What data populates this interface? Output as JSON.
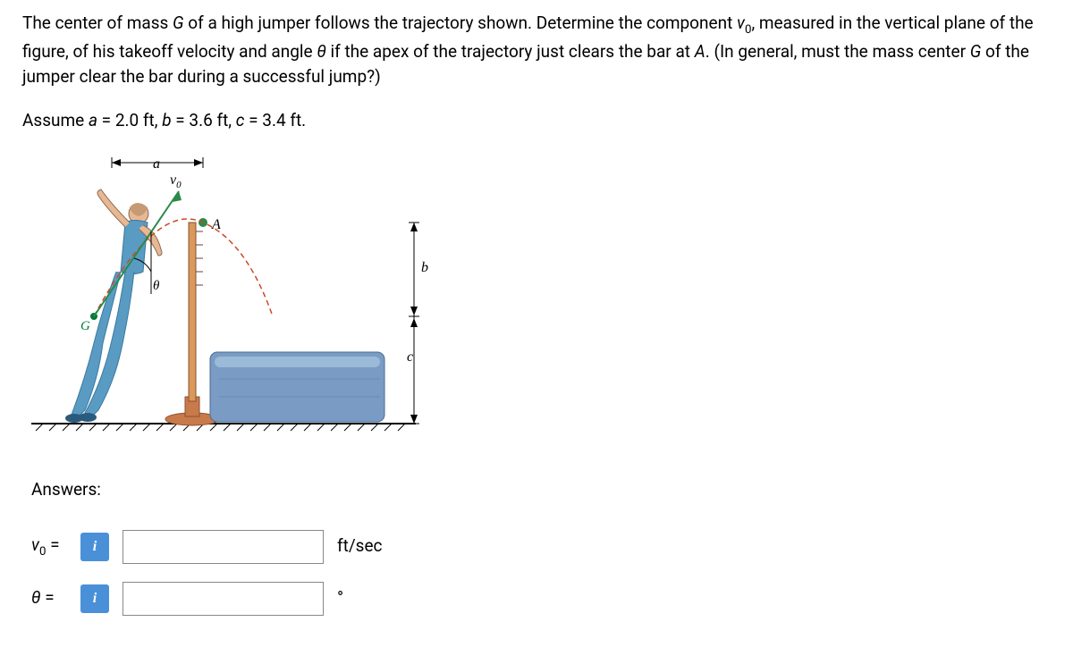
{
  "problem": {
    "text_part1": "The center of mass ",
    "text_G": "G",
    "text_part2": " of a high jumper follows the trajectory shown. Determine the component ",
    "text_v": "v",
    "text_sub0_1": "0",
    "text_part3": ", measured in the vertical plane of the figure, of his takeoff velocity and angle ",
    "text_theta": "θ",
    "text_part4": " if the apex of the trajectory just clears the bar at ",
    "text_A": "A",
    "text_part5": ". (In general, must the mass center ",
    "text_G2": "G",
    "text_part6": " of the jumper clear the bar during a successful jump?)"
  },
  "assume": {
    "prefix": "Assume ",
    "a_label": "a",
    "a_eq": " = 2.0 ft, ",
    "b_label": "b",
    "b_eq": " = 3.6 ft, ",
    "c_label": "c",
    "c_eq": " = 3.4 ft."
  },
  "figure": {
    "label_a": "a",
    "label_v0": "v",
    "label_v0_sub": "0",
    "label_A": "A",
    "label_theta": "θ",
    "label_G": "G",
    "label_b": "b",
    "label_c": "c"
  },
  "answers": {
    "heading": "Answers:",
    "v0_label_v": "v",
    "v0_label_sub": "0",
    "v0_label_eq": " = ",
    "v0_value": "",
    "v0_unit": "ft/sec",
    "theta_label": "θ",
    "theta_label_eq": " = ",
    "theta_value": "",
    "theta_unit": "°",
    "info_icon": "i"
  }
}
